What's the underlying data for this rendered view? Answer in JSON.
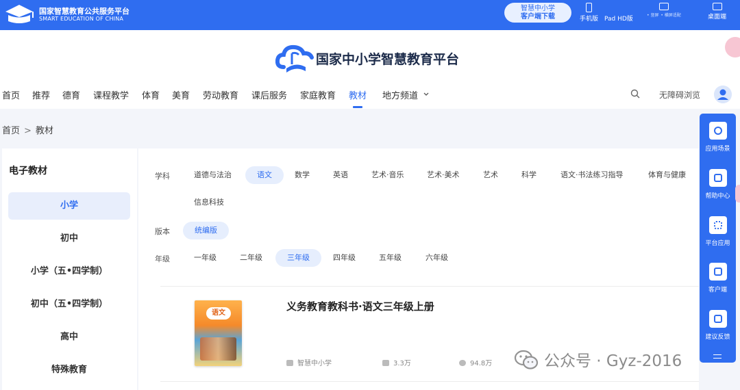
{
  "topbar": {
    "brand_cn": "国家智慧教育公共服务平台",
    "brand_en": "SMART EDUCATION OF CHINA",
    "download_line1": "智慧中小学",
    "download_line2": "客户端下载",
    "devices": [
      {
        "label": "手机版",
        "icon": "mobile-icon"
      },
      {
        "label": "Pad HD版",
        "icon": "tablet-icon"
      },
      {
        "label": "桌面端",
        "icon": "desktop-icon"
      }
    ],
    "small_links": [
      "• 竖屏",
      "• 横屏适配"
    ]
  },
  "header": {
    "title": "国家中小学智慧教育平台",
    "nav": [
      "首页",
      "推荐",
      "德育",
      "课程教学",
      "体育",
      "美育",
      "劳动教育",
      "课后服务",
      "家庭教育",
      "教材",
      "地方频道"
    ],
    "nav_active": "教材",
    "nav_dropdown_icon": "chevron-down-icon",
    "accessibility": "无障碍浏览"
  },
  "breadcrumb": {
    "home": "首页",
    "separator": ">",
    "current": "教材"
  },
  "sidebar": {
    "title": "电子教材",
    "items": [
      "小学",
      "初中",
      "小学（五•四学制）",
      "初中（五•四学制）",
      "高中",
      "特殊教育"
    ],
    "selected": "小学"
  },
  "filters": {
    "subject": {
      "label": "学科",
      "options": [
        "道德与法治",
        "语文",
        "数学",
        "英语",
        "艺术·音乐",
        "艺术·美术",
        "艺术",
        "科学",
        "语文·书法练习指导",
        "体育与健康",
        "信息科技"
      ],
      "selected": "语文"
    },
    "edition": {
      "label": "版本",
      "options": [
        "统编版"
      ],
      "selected": "统编版"
    },
    "grade": {
      "label": "年级",
      "options": [
        "一年级",
        "二年级",
        "三年级",
        "四年级",
        "五年级",
        "六年级"
      ],
      "selected": "三年级"
    }
  },
  "book": {
    "title": "义务教育教科书·语文三年级上册",
    "cover_text": "语文",
    "source": "智慧中小学",
    "likes": "3.3万",
    "views": "94.8万"
  },
  "right_panel": [
    {
      "label": "应用场景",
      "icon": "scenario-icon"
    },
    {
      "label": "帮助中心",
      "icon": "help-icon"
    },
    {
      "label": "平台应用",
      "icon": "apps-icon"
    },
    {
      "label": "客户端",
      "icon": "client-icon"
    },
    {
      "label": "建议反馈",
      "icon": "feedback-icon"
    }
  ],
  "watermark": "公众号 · Gyz-2016",
  "colors": {
    "brand_blue": "#2f6df0",
    "selected_bg": "#e6eefd",
    "page_bg": "#f3f5fa"
  }
}
